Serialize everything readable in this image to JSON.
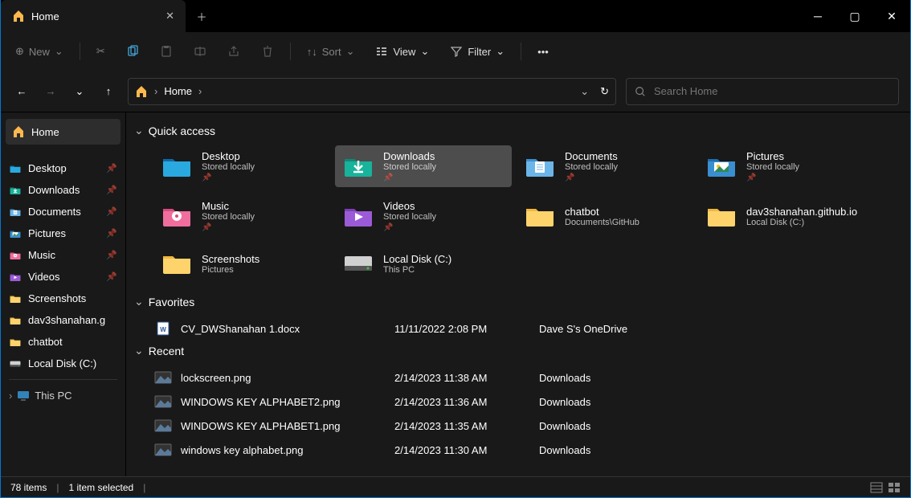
{
  "titlebar": {
    "tab_title": "Home",
    "tab_icon": "home-icon"
  },
  "toolbar": {
    "new_label": "New",
    "sort_label": "Sort",
    "view_label": "View",
    "filter_label": "Filter"
  },
  "breadcrumb": {
    "path": "Home"
  },
  "search": {
    "placeholder": "Search Home"
  },
  "sidebar": {
    "home_label": "Home",
    "items": [
      {
        "label": "Desktop",
        "icon": "desktop",
        "pinned": true
      },
      {
        "label": "Downloads",
        "icon": "downloads",
        "pinned": true
      },
      {
        "label": "Documents",
        "icon": "documents",
        "pinned": true
      },
      {
        "label": "Pictures",
        "icon": "pictures",
        "pinned": true
      },
      {
        "label": "Music",
        "icon": "music",
        "pinned": true
      },
      {
        "label": "Videos",
        "icon": "videos",
        "pinned": true
      },
      {
        "label": "Screenshots",
        "icon": "folder",
        "pinned": false
      },
      {
        "label": "dav3shanahan.g",
        "icon": "folder",
        "pinned": false
      },
      {
        "label": "chatbot",
        "icon": "folder",
        "pinned": false
      },
      {
        "label": "Local Disk (C:)",
        "icon": "disk",
        "pinned": false
      }
    ],
    "tree_label": "This PC"
  },
  "content": {
    "quick_access_label": "Quick access",
    "favorites_label": "Favorites",
    "recent_label": "Recent",
    "quick_access": [
      {
        "name": "Desktop",
        "sub": "Stored locally",
        "icon": "desktop",
        "pin": true
      },
      {
        "name": "Downloads",
        "sub": "Stored locally",
        "icon": "downloads",
        "pin": true,
        "selected": true
      },
      {
        "name": "Documents",
        "sub": "Stored locally",
        "icon": "documents",
        "pin": true
      },
      {
        "name": "Pictures",
        "sub": "Stored locally",
        "icon": "pictures",
        "pin": true
      },
      {
        "name": "Music",
        "sub": "Stored locally",
        "icon": "music",
        "pin": true
      },
      {
        "name": "Videos",
        "sub": "Stored locally",
        "icon": "videos",
        "pin": true
      },
      {
        "name": "chatbot",
        "sub": "Documents\\GitHub",
        "icon": "folder",
        "pin": false
      },
      {
        "name": "dav3shanahan.github.io",
        "sub": "Local Disk (C:)",
        "icon": "folder",
        "pin": false
      },
      {
        "name": "Screenshots",
        "sub": "Pictures",
        "icon": "folder",
        "pin": false
      },
      {
        "name": "Local Disk (C:)",
        "sub": "This PC",
        "icon": "disk",
        "pin": false
      }
    ],
    "favorites": [
      {
        "name": "CV_DWShanahan 1.docx",
        "date": "11/11/2022 2:08 PM",
        "loc": "Dave S's OneDrive",
        "icon": "docx"
      }
    ],
    "recent": [
      {
        "name": "lockscreen.png",
        "date": "2/14/2023 11:38 AM",
        "loc": "Downloads",
        "icon": "png"
      },
      {
        "name": "WINDOWS KEY ALPHABET2.png",
        "date": "2/14/2023 11:36 AM",
        "loc": "Downloads",
        "icon": "png"
      },
      {
        "name": "WINDOWS KEY ALPHABET1.png",
        "date": "2/14/2023 11:35 AM",
        "loc": "Downloads",
        "icon": "png"
      },
      {
        "name": "windows key alphabet.png",
        "date": "2/14/2023 11:30 AM",
        "loc": "Downloads",
        "icon": "png"
      }
    ]
  },
  "statusbar": {
    "item_count": "78 items",
    "selection": "1 item selected"
  }
}
